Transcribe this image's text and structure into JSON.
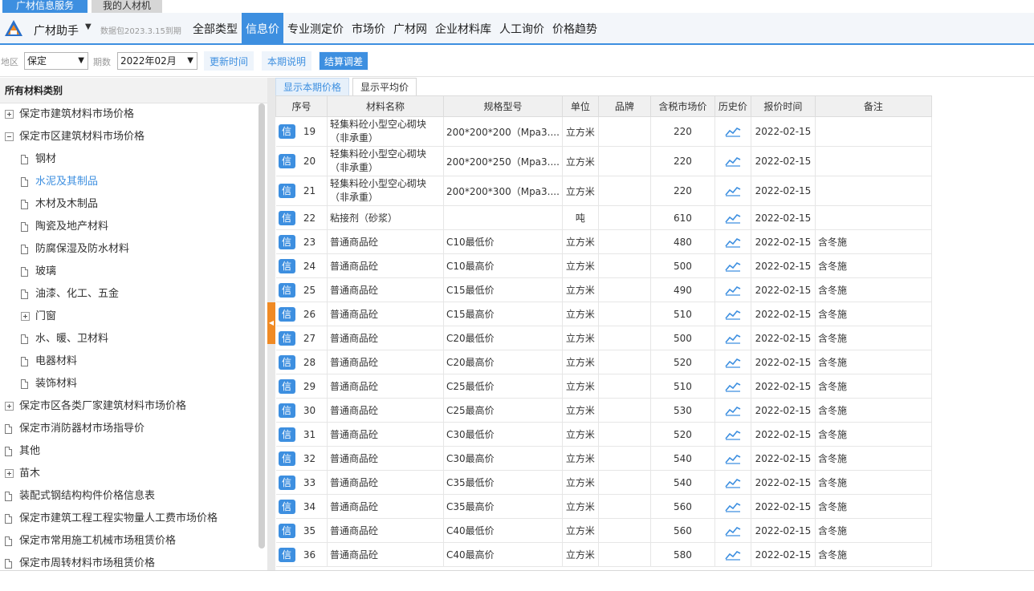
{
  "top_tabs": {
    "active": "广材信息服务",
    "inactive": "我的人材机"
  },
  "header": {
    "app_name": "广材助手",
    "version": "数据包2023.3.15到期",
    "nav": [
      "全部类型",
      "信息价",
      "专业测定价",
      "市场价",
      "广材网",
      "企业材料库",
      "人工询价",
      "价格趋势"
    ],
    "active_nav_index": 1
  },
  "filters": {
    "region_label": "地区",
    "region_value": "保定",
    "period_label": "期数",
    "period_value": "2022年02月",
    "btn_update": "更新时间",
    "btn_explain": "本期说明",
    "btn_settle": "结算调差"
  },
  "left_panel": {
    "title": "所有材料类别",
    "tree": [
      {
        "label": "保定市建筑材料市场价格",
        "level": 0,
        "icon": "plus-box-icon"
      },
      {
        "label": "保定市区建筑材料市场价格",
        "level": 0,
        "icon": "minus-box-icon"
      },
      {
        "label": "钢材",
        "level": 1,
        "icon": "doc-icon"
      },
      {
        "label": "水泥及其制品",
        "level": 1,
        "icon": "doc-icon",
        "selected": true
      },
      {
        "label": "木材及木制品",
        "level": 1,
        "icon": "doc-icon"
      },
      {
        "label": "陶瓷及地产材料",
        "level": 1,
        "icon": "doc-icon"
      },
      {
        "label": "防腐保湿及防水材料",
        "level": 1,
        "icon": "doc-icon"
      },
      {
        "label": "玻璃",
        "level": 1,
        "icon": "doc-icon"
      },
      {
        "label": "油漆、化工、五金",
        "level": 1,
        "icon": "doc-icon"
      },
      {
        "label": "门窗",
        "level": 1,
        "icon": "plus-box-icon"
      },
      {
        "label": "水、暖、卫材料",
        "level": 1,
        "icon": "doc-icon"
      },
      {
        "label": "电器材料",
        "level": 1,
        "icon": "doc-icon"
      },
      {
        "label": "装饰材料",
        "level": 1,
        "icon": "doc-icon"
      },
      {
        "label": "保定市区各类厂家建筑材料市场价格",
        "level": 0,
        "icon": "plus-box-icon"
      },
      {
        "label": "保定市消防器材市场指导价",
        "level": 0,
        "icon": "doc-icon"
      },
      {
        "label": "其他",
        "level": 0,
        "icon": "doc-icon"
      },
      {
        "label": "苗木",
        "level": 0,
        "icon": "plus-box-icon"
      },
      {
        "label": "装配式钢结构构件价格信息表",
        "level": 0,
        "icon": "doc-icon"
      },
      {
        "label": "保定市建筑工程工程实物量人工费市场价格",
        "level": 0,
        "icon": "doc-icon"
      },
      {
        "label": "保定市常用施工机械市场租赁价格",
        "level": 0,
        "icon": "doc-icon"
      },
      {
        "label": "保定市周转材料市场租赁价格",
        "level": 0,
        "icon": "doc-icon"
      }
    ]
  },
  "sub_tabs": [
    "显示本期价格",
    "显示平均价"
  ],
  "table": {
    "badge": "信",
    "columns": [
      "序号",
      "材料名称",
      "规格型号",
      "单位",
      "品牌",
      "含税市场价",
      "历史价",
      "报价时间",
      "备注"
    ],
    "rows": [
      {
        "no": "19",
        "name": "轻集料砼小型空心砌块（非承重）",
        "spec": "200*200*200（Mpa3....",
        "unit": "立方米",
        "brand": "",
        "price": "220",
        "date": "2022-02-15",
        "note": "",
        "tall": true
      },
      {
        "no": "20",
        "name": "轻集料砼小型空心砌块（非承重）",
        "spec": "200*200*250（Mpa3....",
        "unit": "立方米",
        "brand": "",
        "price": "220",
        "date": "2022-02-15",
        "note": "",
        "tall": true
      },
      {
        "no": "21",
        "name": "轻集料砼小型空心砌块（非承重）",
        "spec": "200*200*300（Mpa3....",
        "unit": "立方米",
        "brand": "",
        "price": "220",
        "date": "2022-02-15",
        "note": "",
        "tall": true
      },
      {
        "no": "22",
        "name": "粘接剂（砂浆）",
        "spec": "",
        "unit": "吨",
        "brand": "",
        "price": "610",
        "date": "2022-02-15",
        "note": ""
      },
      {
        "no": "23",
        "name": "普通商品砼",
        "spec": "C10最低价",
        "unit": "立方米",
        "brand": "",
        "price": "480",
        "date": "2022-02-15",
        "note": "含冬施"
      },
      {
        "no": "24",
        "name": "普通商品砼",
        "spec": "C10最高价",
        "unit": "立方米",
        "brand": "",
        "price": "500",
        "date": "2022-02-15",
        "note": "含冬施"
      },
      {
        "no": "25",
        "name": "普通商品砼",
        "spec": "C15最低价",
        "unit": "立方米",
        "brand": "",
        "price": "490",
        "date": "2022-02-15",
        "note": "含冬施"
      },
      {
        "no": "26",
        "name": "普通商品砼",
        "spec": "C15最高价",
        "unit": "立方米",
        "brand": "",
        "price": "510",
        "date": "2022-02-15",
        "note": "含冬施"
      },
      {
        "no": "27",
        "name": "普通商品砼",
        "spec": "C20最低价",
        "unit": "立方米",
        "brand": "",
        "price": "500",
        "date": "2022-02-15",
        "note": "含冬施"
      },
      {
        "no": "28",
        "name": "普通商品砼",
        "spec": "C20最高价",
        "unit": "立方米",
        "brand": "",
        "price": "520",
        "date": "2022-02-15",
        "note": "含冬施"
      },
      {
        "no": "29",
        "name": "普通商品砼",
        "spec": "C25最低价",
        "unit": "立方米",
        "brand": "",
        "price": "510",
        "date": "2022-02-15",
        "note": "含冬施"
      },
      {
        "no": "30",
        "name": "普通商品砼",
        "spec": "C25最高价",
        "unit": "立方米",
        "brand": "",
        "price": "530",
        "date": "2022-02-15",
        "note": "含冬施"
      },
      {
        "no": "31",
        "name": "普通商品砼",
        "spec": "C30最低价",
        "unit": "立方米",
        "brand": "",
        "price": "520",
        "date": "2022-02-15",
        "note": "含冬施"
      },
      {
        "no": "32",
        "name": "普通商品砼",
        "spec": "C30最高价",
        "unit": "立方米",
        "brand": "",
        "price": "540",
        "date": "2022-02-15",
        "note": "含冬施"
      },
      {
        "no": "33",
        "name": "普通商品砼",
        "spec": "C35最低价",
        "unit": "立方米",
        "brand": "",
        "price": "540",
        "date": "2022-02-15",
        "note": "含冬施"
      },
      {
        "no": "34",
        "name": "普通商品砼",
        "spec": "C35最高价",
        "unit": "立方米",
        "brand": "",
        "price": "560",
        "date": "2022-02-15",
        "note": "含冬施"
      },
      {
        "no": "35",
        "name": "普通商品砼",
        "spec": "C40最低价",
        "unit": "立方米",
        "brand": "",
        "price": "560",
        "date": "2022-02-15",
        "note": "含冬施"
      },
      {
        "no": "36",
        "name": "普通商品砼",
        "spec": "C40最高价",
        "unit": "立方米",
        "brand": "",
        "price": "580",
        "date": "2022-02-15",
        "note": "含冬施"
      }
    ]
  },
  "colors": {
    "accent": "#3d8fe0",
    "handle": "#f08a24"
  }
}
